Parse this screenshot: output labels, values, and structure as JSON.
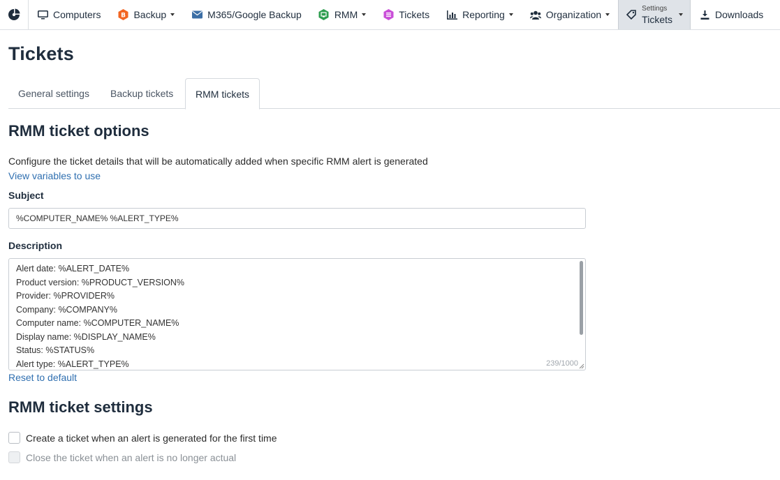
{
  "nav": {
    "logo_icon": "pie-logo-icon",
    "items": [
      {
        "label": "Computers",
        "icon": "monitor-icon",
        "dropdown": false
      },
      {
        "label": "Backup",
        "icon": "backup-hex-icon",
        "dropdown": true
      },
      {
        "label": "M365/Google Backup",
        "icon": "envelope-icon",
        "dropdown": false
      },
      {
        "label": "RMM",
        "icon": "rmm-hex-icon",
        "dropdown": true
      },
      {
        "label": "Tickets",
        "icon": "tickets-hex-icon",
        "dropdown": false
      },
      {
        "label": "Reporting",
        "icon": "chart-icon",
        "dropdown": true
      },
      {
        "label": "Organization",
        "icon": "users-icon",
        "dropdown": true
      }
    ],
    "settings": {
      "small_label": "Settings",
      "label": "Tickets",
      "icon": "tag-icon"
    },
    "downloads": {
      "label": "Downloads",
      "icon": "download-icon"
    }
  },
  "page": {
    "title": "Tickets"
  },
  "tabs": [
    {
      "label": "General settings",
      "active": false
    },
    {
      "label": "Backup tickets",
      "active": false
    },
    {
      "label": "RMM tickets",
      "active": true
    }
  ],
  "options": {
    "title": "RMM ticket options",
    "description": "Configure the ticket details that will be automatically added when specific RMM alert is generated",
    "variables_link": "View variables to use",
    "subject_label": "Subject",
    "subject_value": "%COMPUTER_NAME% %ALERT_TYPE%",
    "description_label": "Description",
    "description_lines": [
      "Alert date: %ALERT_DATE%",
      "Product version: %PRODUCT_VERSION%",
      "Provider: %PROVIDER%",
      "Company: %COMPANY%",
      "Computer name: %COMPUTER_NAME%",
      "Display name: %DISPLAY_NAME%",
      "Status: %STATUS%",
      "Alert type: %ALERT_TYPE%"
    ],
    "char_counter": "239/1000",
    "reset_link": "Reset to default"
  },
  "settings": {
    "title": "RMM ticket settings",
    "checkboxes": [
      {
        "label": "Create a ticket when an alert is generated for the first time",
        "checked": false,
        "disabled": false
      },
      {
        "label": "Close the ticket when an alert is no longer actual",
        "checked": false,
        "disabled": true
      }
    ]
  },
  "colors": {
    "backup_icon": "#f26522",
    "m365_icon": "#3b6ea5",
    "rmm_icon": "#2e9e4f",
    "tickets_icon": "#c94fd8",
    "link": "#2f6fb0",
    "heading": "#1f2d3d"
  }
}
